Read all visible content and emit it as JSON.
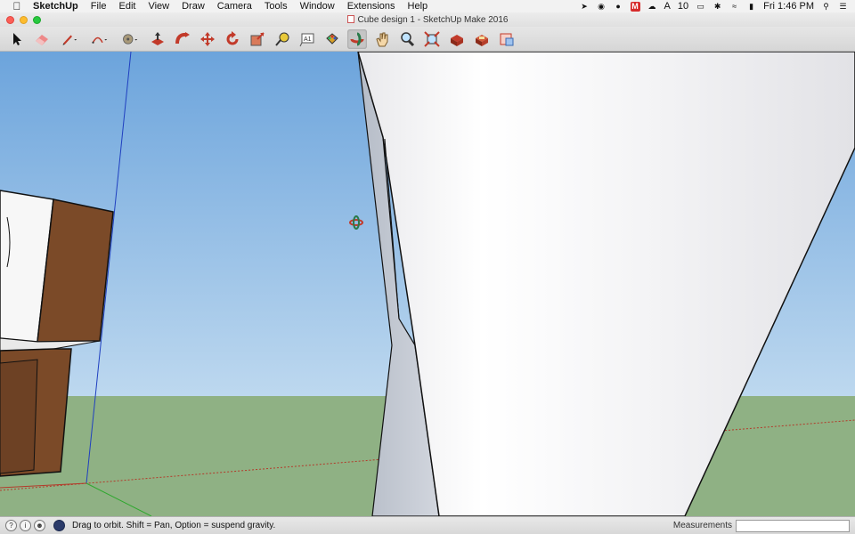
{
  "menubar": {
    "apple": "",
    "items": [
      "SketchUp",
      "File",
      "Edit",
      "View",
      "Draw",
      "Camera",
      "Tools",
      "Window",
      "Extensions",
      "Help"
    ],
    "status": {
      "adobe_count": "10",
      "clock": "Fri 1:46 PM",
      "adobe_mark": "M"
    }
  },
  "window": {
    "title": "Cube design 1 - SketchUp Make 2016"
  },
  "toolbar": {
    "tools": [
      "select",
      "eraser",
      "line",
      "arc",
      "paint",
      "push-pull",
      "follow-me",
      "move",
      "rotate",
      "scale",
      "tape-measure",
      "text",
      "paint-bucket",
      "orbit",
      "pan",
      "zoom",
      "zoom-extents",
      "components",
      "3d-warehouse",
      "extension-warehouse"
    ],
    "active_tool": "orbit"
  },
  "viewport": {
    "colors": {
      "sky_top": "#6fa6dc",
      "sky_bottom": "#b9d6ee",
      "ground": "#8fb184",
      "brown_face": "#7b4a28",
      "white_face": "#f7f7f7",
      "cone_side": "#c4cad3",
      "axis_blue": "#1f3fc0",
      "axis_red": "#b33a2a",
      "axis_green": "#2fa82f"
    }
  },
  "statusbar": {
    "hint": "Drag to orbit. Shift = Pan, Option = suspend gravity.",
    "measurements_label": "Measurements",
    "measurements_value": ""
  }
}
